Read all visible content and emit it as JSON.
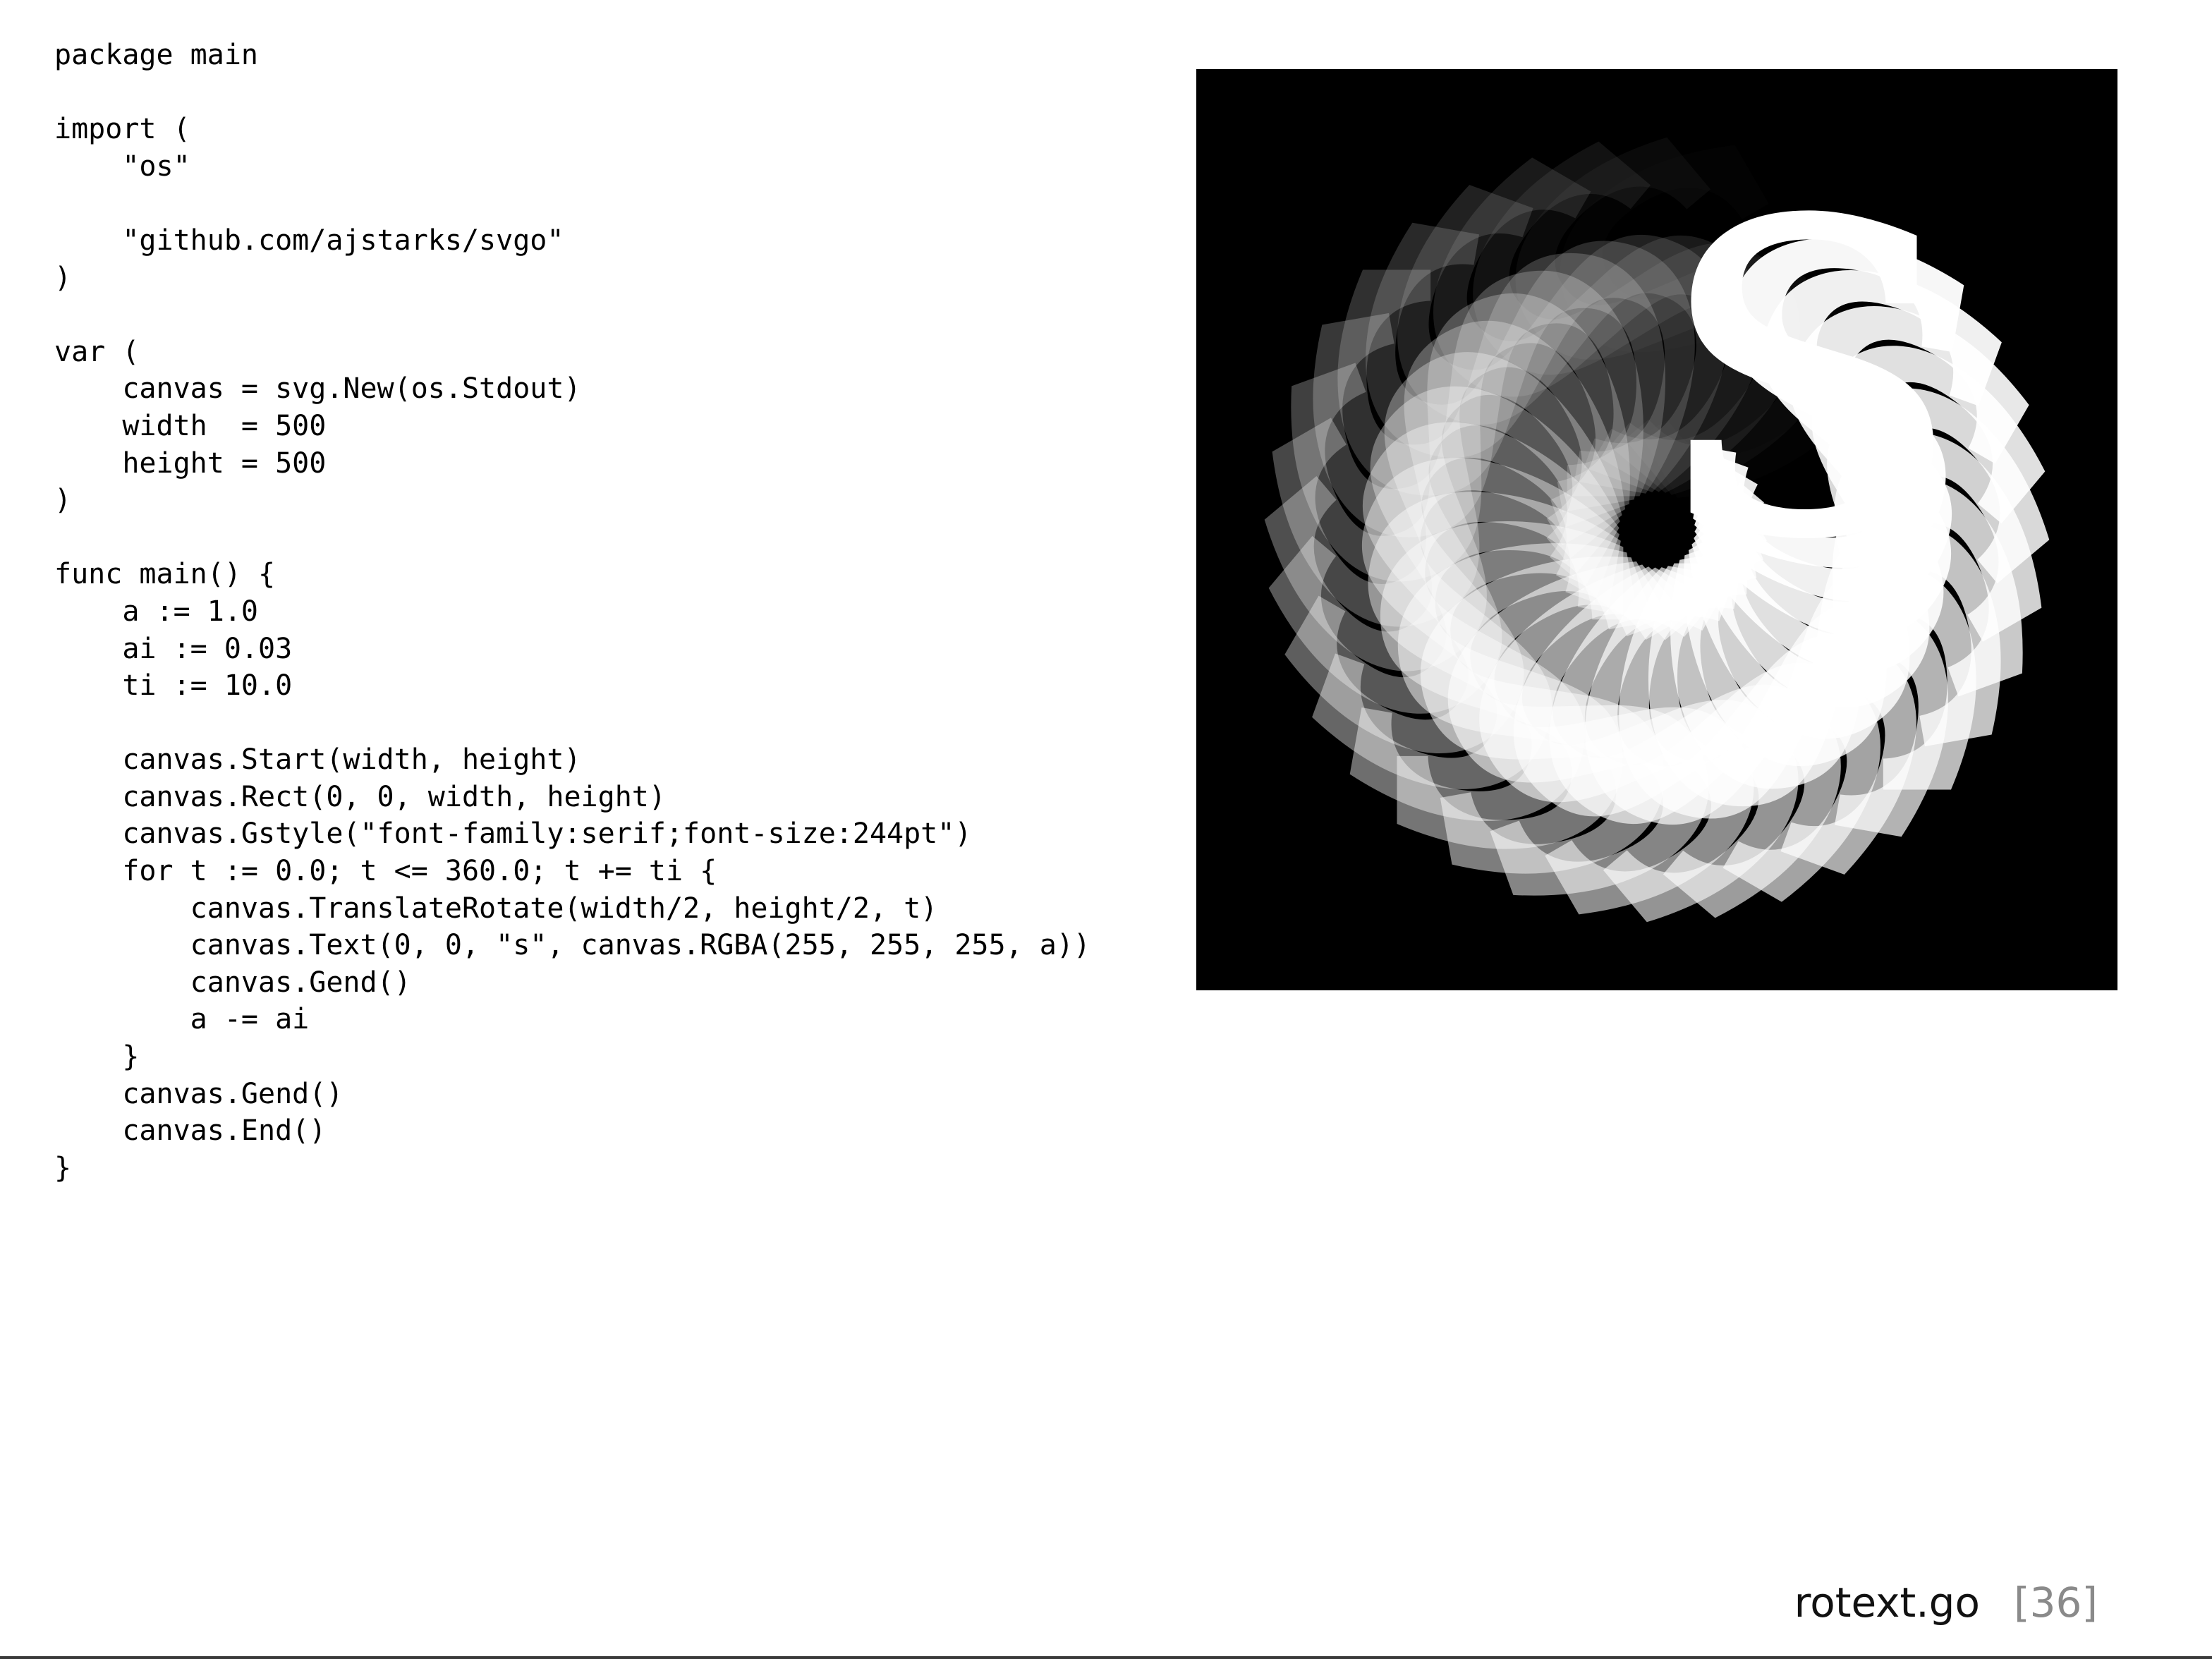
{
  "code": {
    "lines": [
      "package main",
      "",
      "import (",
      "    \"os\"",
      "",
      "    \"github.com/ajstarks/svgo\"",
      ")",
      "",
      "var (",
      "    canvas = svg.New(os.Stdout)",
      "    width  = 500",
      "    height = 500",
      ")",
      "",
      "func main() {",
      "    a := 1.0",
      "    ai := 0.03",
      "    ti := 10.0",
      "",
      "    canvas.Start(width, height)",
      "    canvas.Rect(0, 0, width, height)",
      "    canvas.Gstyle(\"font-family:serif;font-size:244pt\")",
      "    for t := 0.0; t <= 360.0; t += ti {",
      "        canvas.TranslateRotate(width/2, height/2, t)",
      "        canvas.Text(0, 0, \"s\", canvas.RGBA(255, 255, 255, a))",
      "        canvas.Gend()",
      "        a -= ai",
      "    }",
      "    canvas.Gend()",
      "    canvas.End()",
      "}"
    ]
  },
  "figure": {
    "glyph": "s",
    "background_color": "#000000",
    "glyph_color": "#ffffff",
    "rotation_step_deg": 10,
    "rotation_max_deg": 360,
    "alpha_start": 1.0,
    "alpha_step": 0.03
  },
  "footer": {
    "title": "rotext.go",
    "page": "[36]"
  }
}
